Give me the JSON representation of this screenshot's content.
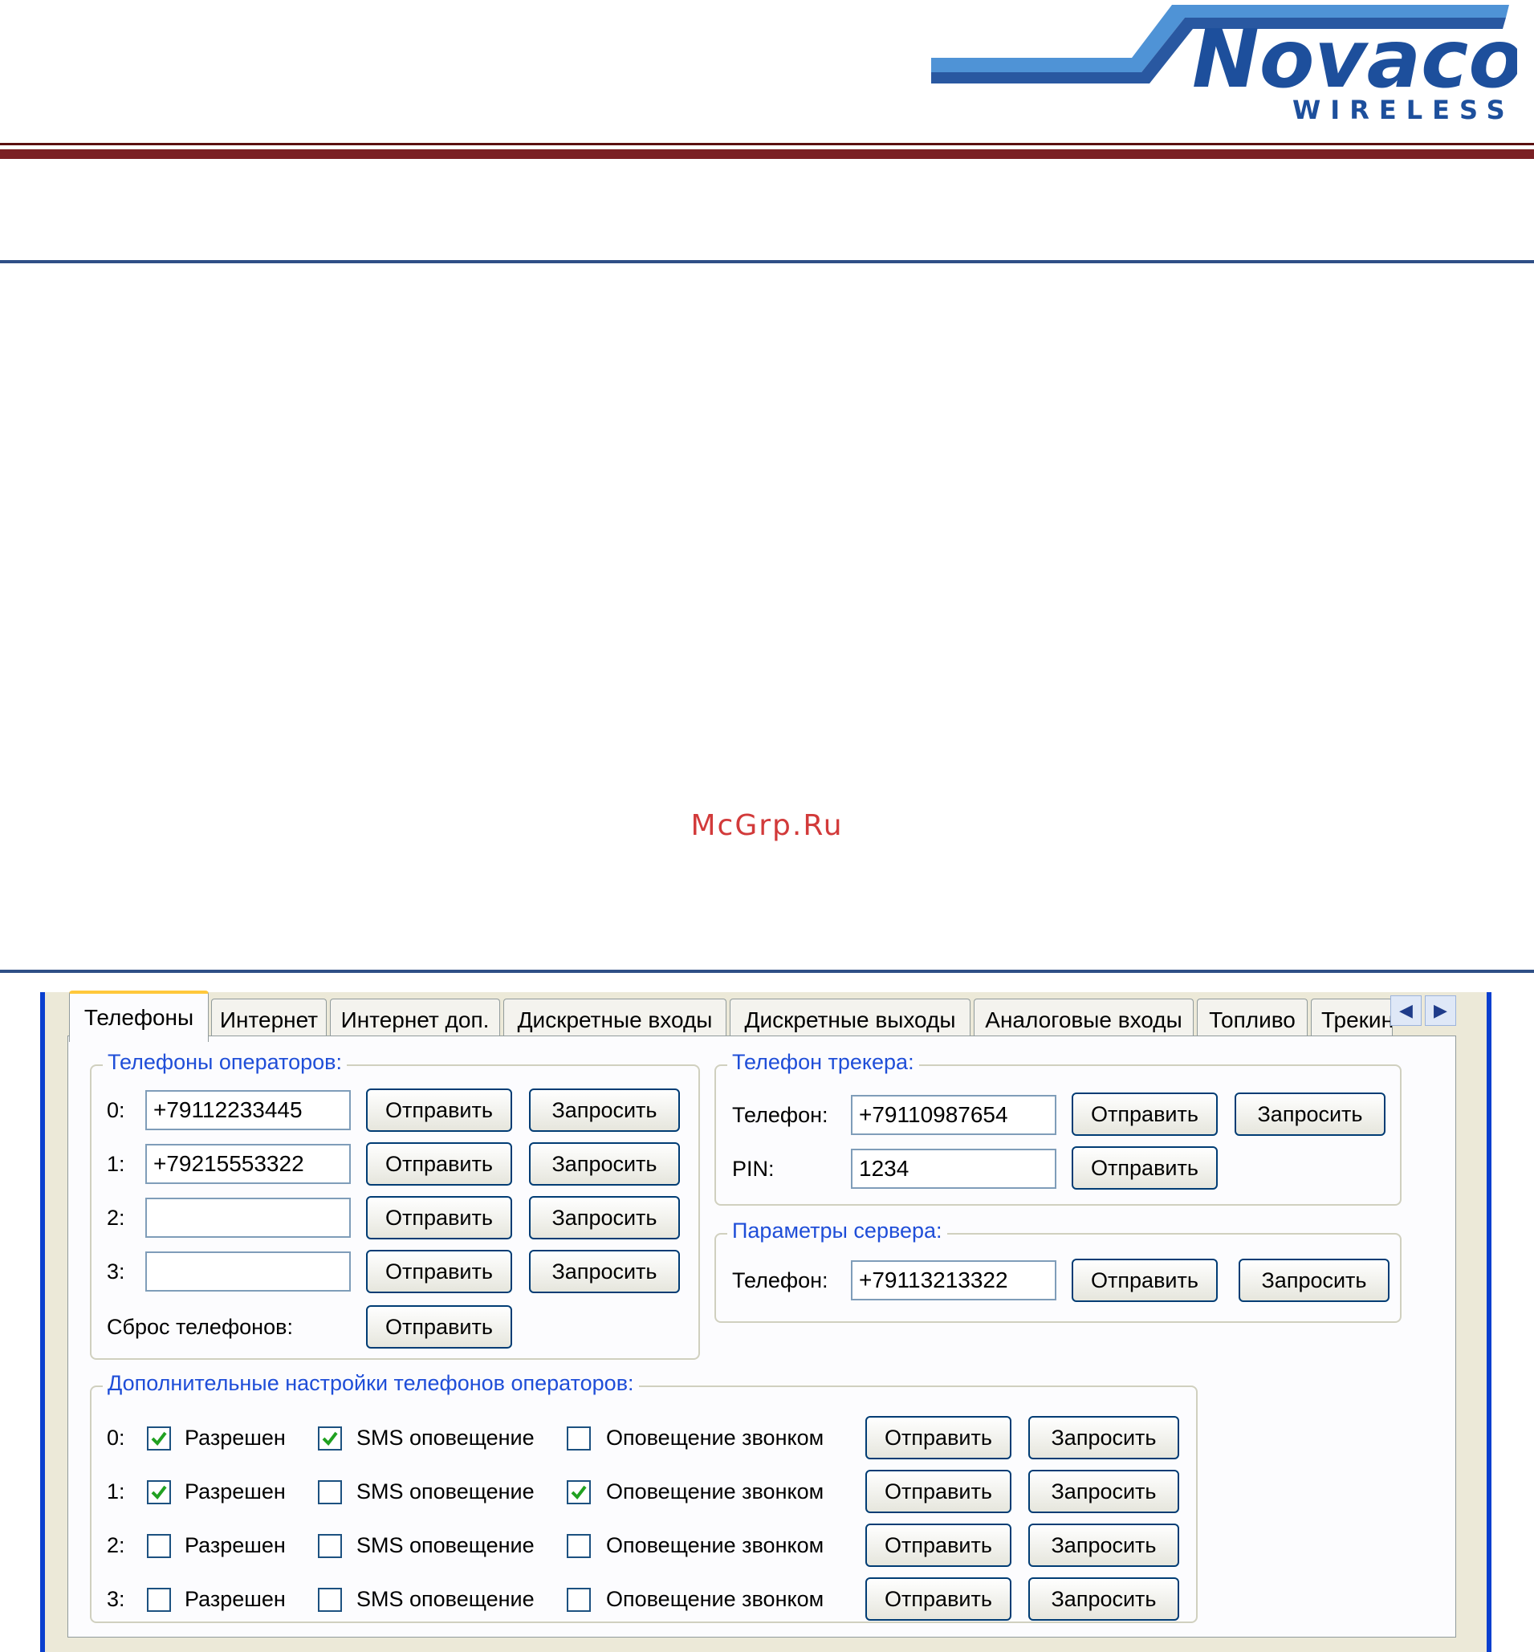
{
  "header": {
    "logo_text": "Novacom",
    "logo_sub": "WIRELESS"
  },
  "watermark": "McGrp.Ru",
  "tabs": [
    {
      "label": "Телефоны",
      "active": true
    },
    {
      "label": "Интернет"
    },
    {
      "label": "Интернет доп."
    },
    {
      "label": "Дискретные входы"
    },
    {
      "label": "Дискретные выходы"
    },
    {
      "label": "Аналоговые входы"
    },
    {
      "label": "Топливо"
    },
    {
      "label": "Трекинг"
    }
  ],
  "operators": {
    "legend": "Телефоны операторов:",
    "rows": [
      {
        "index": "0:",
        "value": "+79112233445"
      },
      {
        "index": "1:",
        "value": "+79215553322"
      },
      {
        "index": "2:",
        "value": ""
      },
      {
        "index": "3:",
        "value": ""
      }
    ],
    "reset_label": "Сброс телефонов:"
  },
  "buttons": {
    "send": "Отправить",
    "request": "Запросить"
  },
  "tracker": {
    "legend": "Телефон трекера:",
    "phone_label": "Телефон:",
    "phone_value": "+79110987654",
    "pin_label": "PIN:",
    "pin_value": "1234"
  },
  "server": {
    "legend": "Параметры сервера:",
    "phone_label": "Телефон:",
    "phone_value": "+79113213322"
  },
  "extra": {
    "legend": "Дополнительные настройки телефонов операторов:",
    "labels": {
      "allowed": "Разрешен",
      "sms": "SMS оповещение",
      "call": "Оповещение звонком"
    },
    "rows": [
      {
        "index": "0:",
        "allowed": true,
        "sms": true,
        "call": false
      },
      {
        "index": "1:",
        "allowed": true,
        "sms": false,
        "call": true
      },
      {
        "index": "2:",
        "allowed": false,
        "sms": false,
        "call": false
      },
      {
        "index": "3:",
        "allowed": false,
        "sms": false,
        "call": false
      }
    ]
  },
  "colors": {
    "accent_blue": "#1f4ed8",
    "brand_blue": "#1d4f9c",
    "brand_light": "#4f93d6",
    "rule_red": "#7b2024",
    "check_green": "#21a121"
  }
}
